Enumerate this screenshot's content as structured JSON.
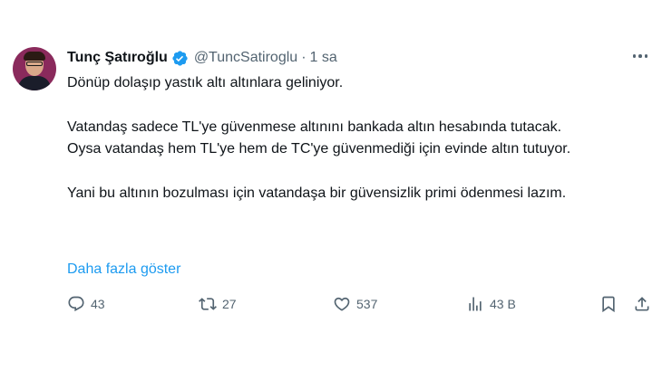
{
  "author": {
    "name": "Tunç Şatıroğlu",
    "handle": "@TuncSatiroglu",
    "separator": "·",
    "time": "1 sa"
  },
  "tweet": {
    "paragraphs": [
      "Dönüp dolaşıp yastık altı altınlara geliniyor.",
      "Vatandaş sadece TL'ye güvenmese altınını bankada altın hesabında tutacak. Oysa vatandaş hem TL'ye hem de TC'ye güvenmediği için evinde altın tutuyor.",
      "Yani bu altının bozulması için vatandaşa bir güvensizlik primi ödenmesi lazım."
    ],
    "show_more": "Daha fazla göster"
  },
  "actions": {
    "reply_count": "43",
    "retweet_count": "27",
    "like_count": "537",
    "view_count": "43 B"
  },
  "colors": {
    "accent": "#1d9bf0",
    "text": "#0f1419",
    "muted": "#536471"
  }
}
